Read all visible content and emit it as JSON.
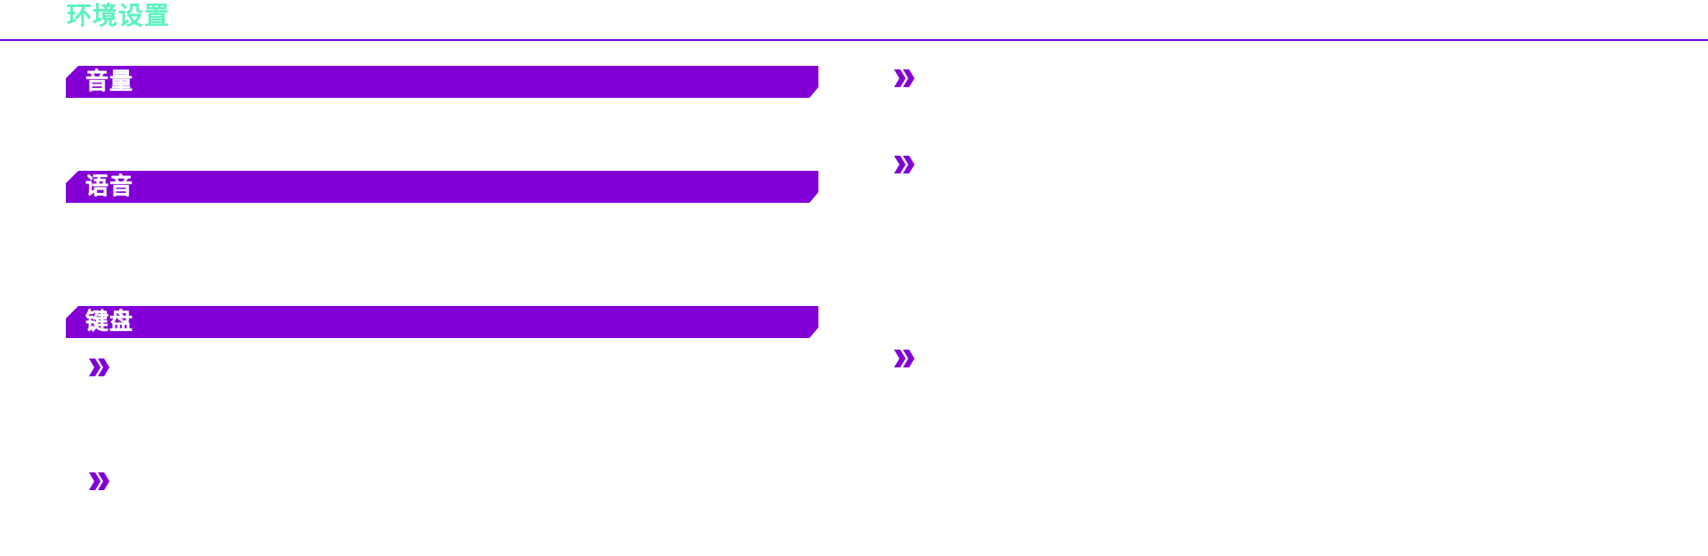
{
  "colors": {
    "title": "#5ef2c2",
    "accent": "#8200d6",
    "header_text": "#ffffff"
  },
  "header": {
    "title": "环境设置"
  },
  "sections": {
    "volume": {
      "label": "音量"
    },
    "voice": {
      "label": "语音"
    },
    "keyboard": {
      "label": "键盘"
    }
  },
  "icons": {
    "bullet": "double-chevron-right-icon"
  }
}
